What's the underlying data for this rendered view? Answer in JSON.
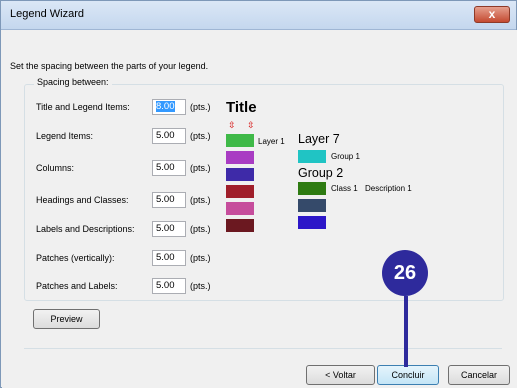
{
  "window": {
    "title": "Legend Wizard",
    "close_label": "x"
  },
  "instruction": "Set the spacing between the parts of your legend.",
  "spacing_group": {
    "label": "Spacing between:",
    "unit": "(pts.)",
    "rows": [
      {
        "label": "Title and Legend Items:",
        "value": "8.00"
      },
      {
        "label": "Legend Items:",
        "value": "5.00"
      },
      {
        "label": "Columns:",
        "value": "5.00"
      },
      {
        "label": "Headings and Classes:",
        "value": "5.00"
      },
      {
        "label": "Labels and Descriptions:",
        "value": "5.00"
      },
      {
        "label": "Patches (vertically):",
        "value": "5.00"
      },
      {
        "label": "Patches and Labels:",
        "value": "5.00"
      }
    ]
  },
  "preview": {
    "title": "Title",
    "arrows": "⇳",
    "column1_label": "Layer 1",
    "column1_patches": [
      "#3fb948",
      "#a93cc3",
      "#3e2aa8",
      "#a01e2a",
      "#c64d9c",
      "#6b1820"
    ],
    "layer7": "Layer 7",
    "group1": "Group 1",
    "group1_color": "#20c4c4",
    "group2": "Group 2",
    "class1": "Class 1",
    "description1": "Description 1",
    "group2_patches": [
      "#2e7b12",
      "#354a6a",
      "#2c16c8"
    ]
  },
  "buttons": {
    "preview": "Preview",
    "back": "< Voltar",
    "finish": "Concluir",
    "cancel": "Cancelar"
  },
  "callout": {
    "number": "26"
  }
}
